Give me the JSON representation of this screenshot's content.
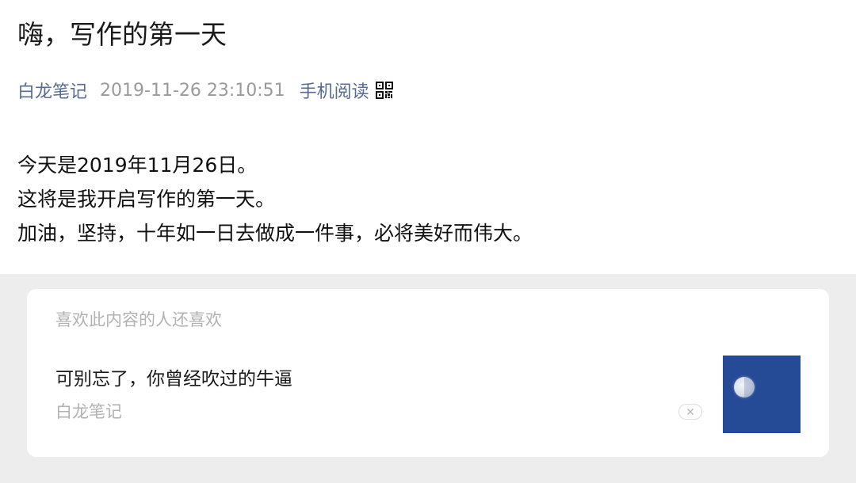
{
  "article": {
    "title": "嗨，写作的第一天",
    "meta": {
      "author": "白龙笔记",
      "date": "2019-11-26 23:10:51",
      "mobile_read_label": "手机阅读",
      "qr_icon": "qr-code-icon"
    },
    "paragraphs": [
      "今天是2019年11月26日。",
      "这将是我开启写作的第一天。",
      "加油，坚持，十年如一日去做成一件事，必将美好而伟大。"
    ]
  },
  "related": {
    "header": "喜欢此内容的人还喜欢",
    "items": [
      {
        "title": "可别忘了，你曾经吹过的牛逼",
        "source": "白龙笔记",
        "dismiss_icon": "close-icon",
        "thumbnail": "moon-in-blue-sky-image"
      }
    ]
  },
  "colors": {
    "link": "#576b95",
    "meta_gray": "#9a9a9a",
    "section_bg": "#ededed",
    "thumbnail_bg": "#264b96"
  }
}
